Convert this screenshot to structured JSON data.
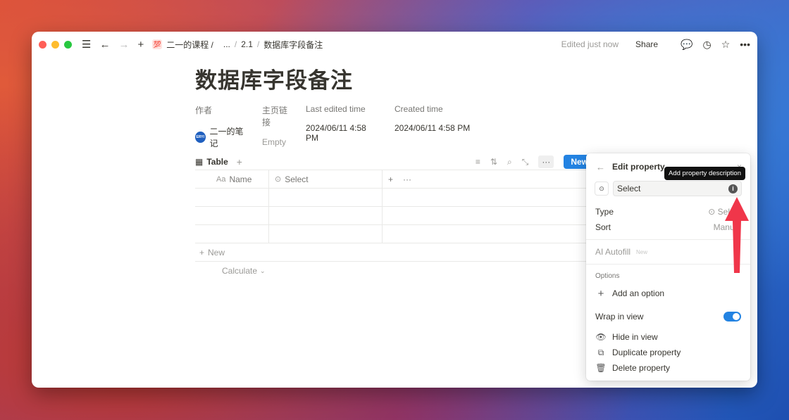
{
  "titlebar": {
    "breadcrumb": [
      "二一的课程 /",
      "...",
      "2.1",
      "数据库字段备注"
    ],
    "edited": "Edited just now",
    "share": "Share"
  },
  "page": {
    "title": "数据库字段备注",
    "properties": [
      {
        "label": "作者",
        "value": "二一的笔记",
        "avatar": "ERYI"
      },
      {
        "label": "主页链接",
        "value": "Empty"
      },
      {
        "label": "Last edited time",
        "value": "2024/06/11 4:58 PM"
      },
      {
        "label": "Created time",
        "value": "2024/06/11 4:58 PM"
      }
    ]
  },
  "database": {
    "view_tab": "Table",
    "new_button": "New",
    "columns": [
      {
        "icon": "Aa",
        "label": "Name"
      },
      {
        "icon": "⊙",
        "label": "Select"
      }
    ],
    "new_row": "New",
    "calculate": "Calculate"
  },
  "edit_property": {
    "title": "Edit property",
    "name_value": "Select",
    "tooltip": "Add property description",
    "type_label": "Type",
    "type_value": "Select",
    "sort_label": "Sort",
    "sort_value": "Manual",
    "ai_autofill": "AI Autofill",
    "ai_badge": "New",
    "options_label": "Options",
    "add_option": "Add an option",
    "wrap_label": "Wrap in view",
    "wrap_on": true,
    "hide": "Hide in view",
    "duplicate": "Duplicate property",
    "delete": "Delete property"
  },
  "colors": {
    "accent": "#2383e2",
    "arrow": "#f0364a"
  }
}
